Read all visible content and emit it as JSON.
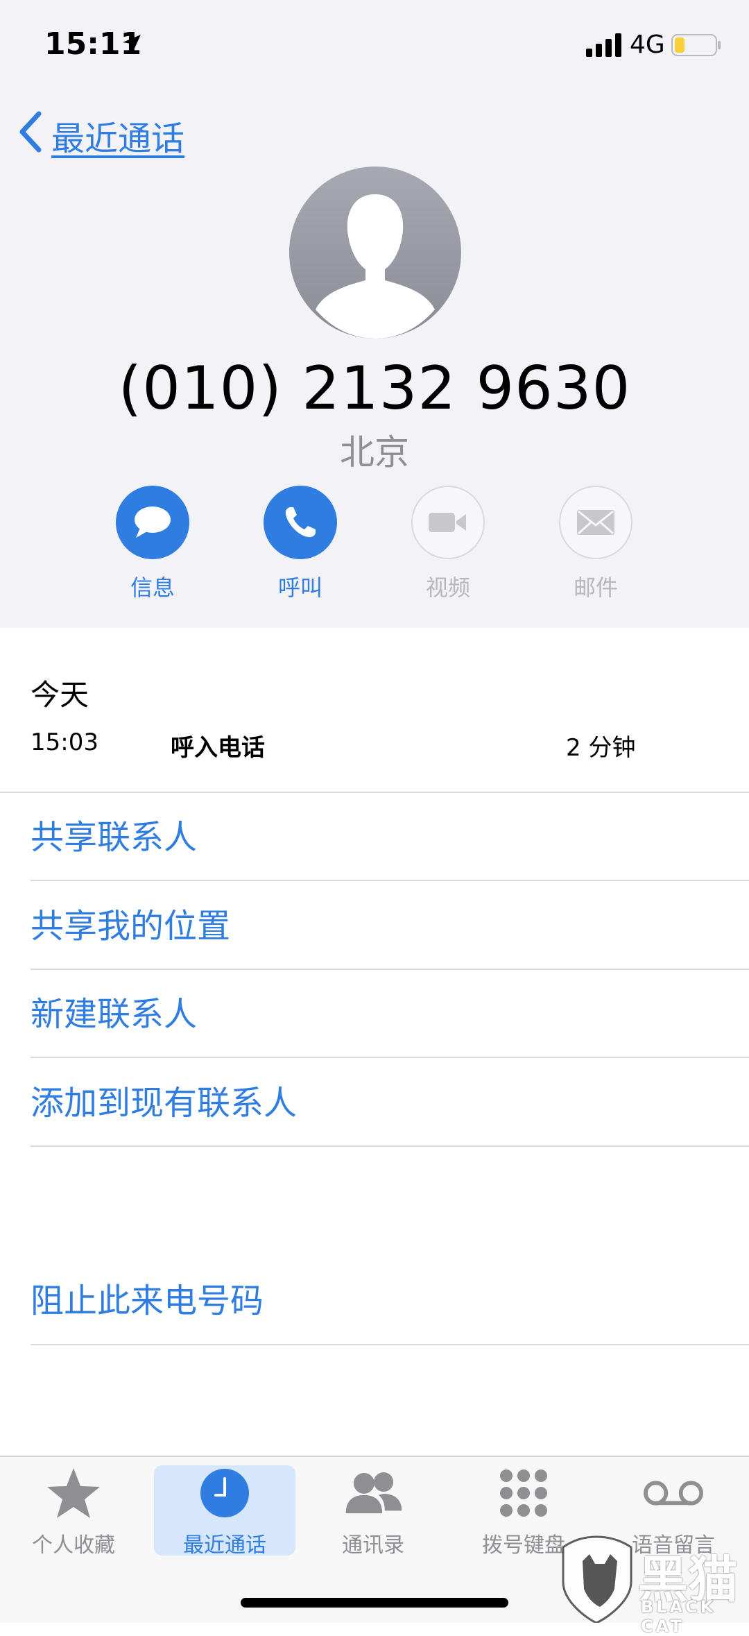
{
  "status_bar": {
    "time": "15:11",
    "network": "4G"
  },
  "nav": {
    "back_label": "最近通话"
  },
  "contact": {
    "phone_number": "(010) 2132 9630",
    "location": "北京"
  },
  "actions": [
    {
      "label": "信息",
      "icon": "message-icon",
      "enabled": true
    },
    {
      "label": "呼叫",
      "icon": "phone-icon",
      "enabled": true
    },
    {
      "label": "视频",
      "icon": "video-icon",
      "enabled": false
    },
    {
      "label": "邮件",
      "icon": "mail-icon",
      "enabled": false
    }
  ],
  "call_log": {
    "date_label": "今天",
    "entry": {
      "time": "15:03",
      "type": "呼入电话",
      "duration": "2 分钟"
    }
  },
  "menu": {
    "share_contact": "共享联系人",
    "share_location": "共享我的位置",
    "new_contact": "新建联系人",
    "add_existing": "添加到现有联系人",
    "block": "阻止此来电号码"
  },
  "tabs": [
    {
      "label": "个人收藏",
      "icon": "star-icon",
      "selected": false
    },
    {
      "label": "最近通话",
      "icon": "clock-icon",
      "selected": true
    },
    {
      "label": "通讯录",
      "icon": "contacts-icon",
      "selected": false
    },
    {
      "label": "拨号键盘",
      "icon": "keypad-icon",
      "selected": false
    },
    {
      "label": "语音留言",
      "icon": "voicemail-icon",
      "selected": false
    }
  ],
  "watermark": {
    "text_cn": "黑猫",
    "text_en": "BLACK CAT"
  },
  "colors": {
    "accent": "#2f7de1",
    "header_bg": "#f2f2f7",
    "inactive": "#b7b7bc"
  }
}
